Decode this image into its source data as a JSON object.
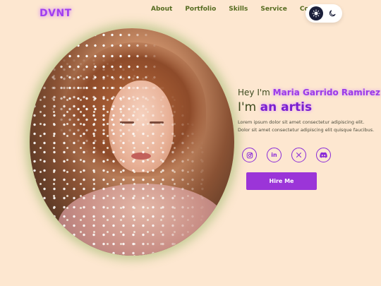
{
  "brand": {
    "logo": "DVNT",
    "accent": "#9b35d8"
  },
  "nav": {
    "items": [
      "About",
      "Portfolio",
      "Skills",
      "Service",
      "Contact"
    ]
  },
  "theme_toggle": {
    "options": [
      "light",
      "dark"
    ],
    "icons": [
      "sun-icon",
      "moon-icon"
    ]
  },
  "hero": {
    "greeting_prefix": "Hey I'm ",
    "name": "Maria Garrido Ramirez",
    "role_prefix": "I'm ",
    "role": "an artis",
    "description": "Lorem ipsum dolor sit amet consectetur adipiscing elit. Dolor sit amet consectetur adipiscing elit quisque faucibus.",
    "cta_label": "Hire Me"
  },
  "socials": [
    {
      "name": "instagram",
      "glyph": "◎"
    },
    {
      "name": "linkedin",
      "glyph": "in"
    },
    {
      "name": "x",
      "glyph": "𝕏"
    },
    {
      "name": "discord",
      "glyph": "◉"
    }
  ]
}
